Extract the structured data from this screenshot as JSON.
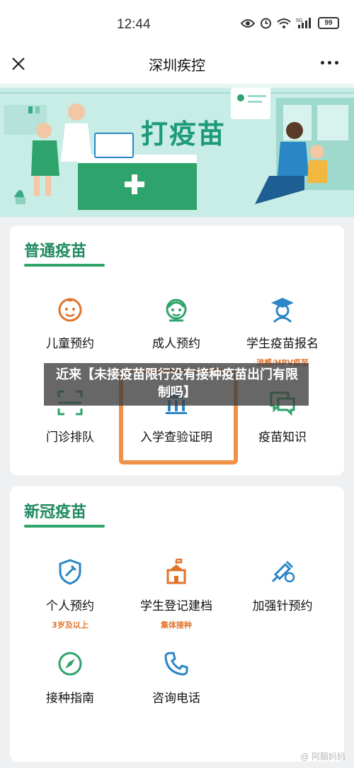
{
  "status_bar": {
    "time": "12:44",
    "network": "5G",
    "battery": "99"
  },
  "nav": {
    "title": "深圳疾控",
    "close_icon": "close-icon",
    "more_icon": "more-icon"
  },
  "banner": {
    "headline": "打疫苗"
  },
  "section_regular": {
    "title": "普通疫苗",
    "items": [
      {
        "label": "儿童预约",
        "icon": "child-face-icon"
      },
      {
        "label": "成人预约",
        "icon": "adult-face-icon"
      },
      {
        "label": "学生疫苗报名",
        "icon": "graduate-icon",
        "sub": "流感/HPV疫苗"
      },
      {
        "label": "门诊排队",
        "icon": "scan-icon"
      },
      {
        "label": "入学查验证明",
        "icon": "school-icon"
      },
      {
        "label": "疫苗知识",
        "icon": "chat-icon"
      }
    ]
  },
  "section_covid": {
    "title": "新冠疫苗",
    "items": [
      {
        "label": "个人预约",
        "icon": "vaccine-shield-icon",
        "sub": "3岁及以上"
      },
      {
        "label": "学生登记建档",
        "icon": "school-building-icon",
        "sub": "集体接种"
      },
      {
        "label": "加强针预约",
        "icon": "syringe-icon"
      },
      {
        "label": "接种指南",
        "icon": "compass-icon"
      },
      {
        "label": "咨询电话",
        "icon": "phone-icon"
      }
    ]
  },
  "overlay": {
    "caption": "近来【未接疫苗限行没有接种疫苗出门有限制吗】"
  },
  "watermark": {
    "text": "@ 阿胭妈妈"
  },
  "colors": {
    "brand_green": "#1f8a5f",
    "accent_orange": "#e0732b",
    "icon_blue": "#2b86c5",
    "icon_green": "#2ea36b"
  }
}
